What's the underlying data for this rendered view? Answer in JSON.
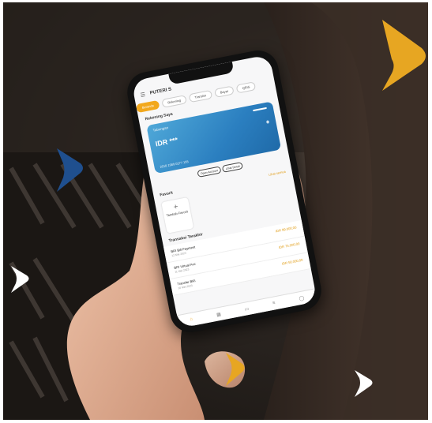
{
  "colors": {
    "accent": "#f2a81d",
    "card_blue": "#2b7fc0",
    "arrow_blue": "#1f4f8e",
    "arrow_white": "#ffffff"
  },
  "decor": {
    "arrows": [
      "yellow-arrow",
      "blue-arrow",
      "white-arrow",
      "yellow-arrow",
      "white-arrow"
    ]
  },
  "app": {
    "username": "PUTERI S",
    "tabs": [
      "Beranda",
      "Rekening",
      "Transfer",
      "Bayar",
      "QRIS"
    ],
    "account_section": "Rekening Saya",
    "card": {
      "type": "Tabungan",
      "balance": "IDR ***",
      "number": "2018 1989 0277 155"
    },
    "card_actions": [
      "Open Account",
      "Lihat Detail"
    ],
    "favorite_section": "Favorit",
    "see_all": "Lihat semua",
    "add_favorite": "Tambah Favorit",
    "transactions_section": "Transaksi Terakhir",
    "transactions": [
      {
        "name": "BRI Bill Payment",
        "date": "12 Mei 2023",
        "amount": "IDR 99.000,00"
      },
      {
        "name": "BRI Virtual Acc",
        "date": "11 Mei 2023",
        "amount": "IDR 75.000,00"
      },
      {
        "name": "Transfer BRI",
        "date": "10 Mei 2023",
        "amount": "IDR 50.000,00"
      }
    ],
    "nav": [
      "home-icon",
      "qris-icon",
      "card-icon",
      "history-icon",
      "profile-icon"
    ]
  }
}
